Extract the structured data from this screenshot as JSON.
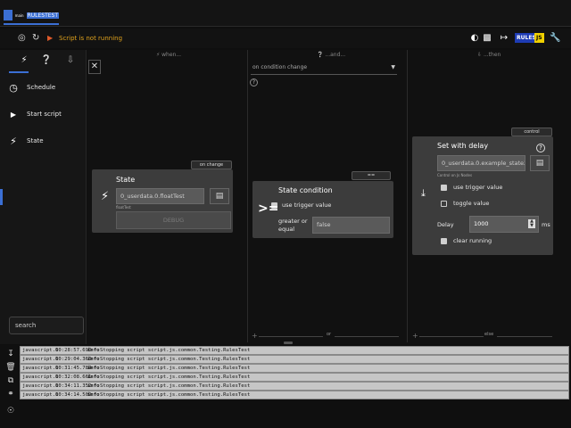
{
  "tab": {
    "prefix": "main",
    "name": "RULESTEST"
  },
  "toolbar": {
    "status": "Script is not running",
    "rules_label": "RULES",
    "js_label": "JS"
  },
  "sidebar": {
    "items": [
      {
        "label": "Schedule",
        "icon": "clock-icon"
      },
      {
        "label": "Start script",
        "icon": "play-icon"
      },
      {
        "label": "State",
        "icon": "bolt-icon"
      }
    ],
    "search_placeholder": "search"
  },
  "columns": {
    "when": "when...",
    "and": "...and...",
    "then": "...then"
  },
  "condition_select": "on condition change",
  "state_card": {
    "tag": "on change",
    "title": "State",
    "object_id": "0_userdata.0.floatTest",
    "object_sublabel": "floatTest",
    "button": "DEBUG"
  },
  "condition_card": {
    "tag": "==",
    "title": "State condition",
    "use_trigger_label": "use trigger value",
    "operator_symbol": ">=",
    "operator_label": "greater or equal",
    "value": "false"
  },
  "action_card": {
    "tag": "control",
    "title": "Set with delay",
    "object_id": "0_userdata.0.example_state2",
    "object_sublabel": "Control on Js Nodes",
    "use_trigger_label": "use trigger value",
    "toggle_label": "toggle value",
    "delay_label": "Delay",
    "delay_value": "1000",
    "delay_unit": "ms",
    "clear_label": "clear running"
  },
  "bottom": {
    "or": "or",
    "else": "else"
  },
  "logs": [
    {
      "source": "javascript.0",
      "time": "10:28:57.690",
      "level": "info",
      "message": "Stopping script script.js.common.Testing.RulesTest"
    },
    {
      "source": "javascript.0",
      "time": "10:29:04.363",
      "level": "info",
      "message": "Stopping script script.js.common.Testing.RulesTest"
    },
    {
      "source": "javascript.0",
      "time": "10:31:45.784",
      "level": "info",
      "message": "Stopping script script.js.common.Testing.RulesTest"
    },
    {
      "source": "javascript.0",
      "time": "10:32:08.661",
      "level": "info",
      "message": "Stopping script script.js.common.Testing.RulesTest"
    },
    {
      "source": "javascript.0",
      "time": "10:34:11.352",
      "level": "info",
      "message": "Stopping script script.js.common.Testing.RulesTest"
    },
    {
      "source": "javascript.0",
      "time": "10:34:14.509",
      "level": "info",
      "message": "Stopping script script.js.common.Testing.RulesTest"
    }
  ]
}
